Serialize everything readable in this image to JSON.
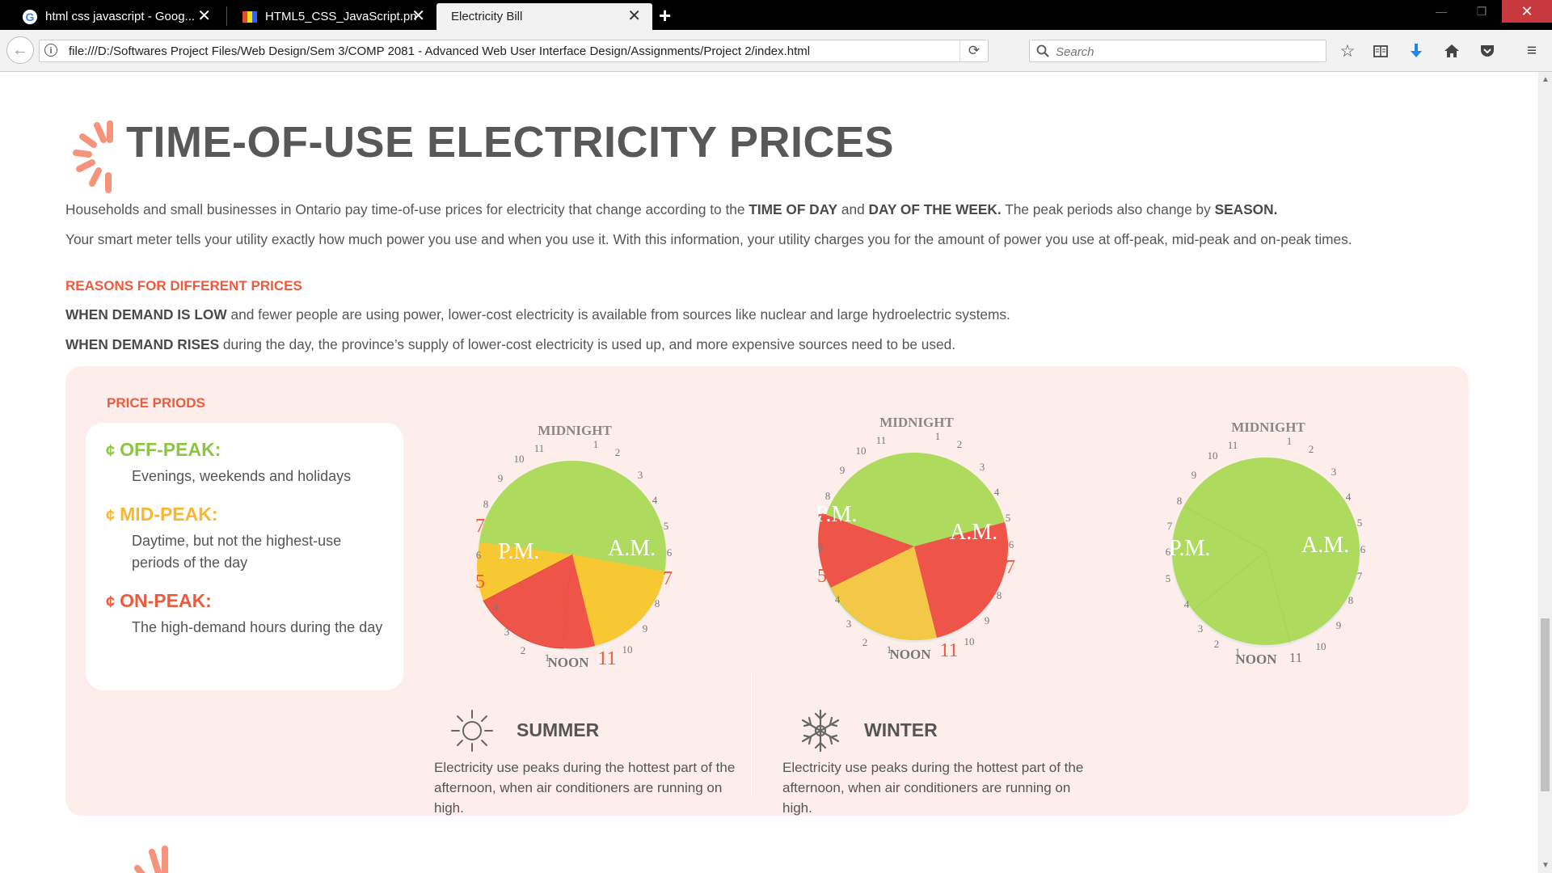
{
  "browser": {
    "tabs": [
      {
        "label": "html css javascript - Goog..."
      },
      {
        "label": "HTML5_CSS_JavaScript.pn..."
      },
      {
        "label": "Electricity Bill"
      }
    ],
    "url": "file:///D:/Softwares Project Files/Web Design/Sem 3/COMP 2081 - Advanced Web User Interface Design/Assignments/Project 2/index.html",
    "search_placeholder": "Search"
  },
  "page": {
    "title": "TIME-OF-USE ELECTRICITY PRICES",
    "intro1": {
      "a": "Households and small businesses in Ontario pay time-of-use prices for electricity that change according to the ",
      "b": "TIME OF DAY",
      "c": " and ",
      "d": "DAY OF THE WEEK.",
      "e": " The peak periods also change by ",
      "f": "SEASON."
    },
    "intro2": "Your smart meter tells your utility exactly how much power you use and when you use it. With this information, your utility charges you for the amount of power you use at off-peak, mid-peak and on-peak times.",
    "reasons_heading": "REASONS FOR DIFFERENT PRICES",
    "reason1": {
      "bold": "WHEN DEMAND IS LOW",
      "rest": " and fewer people are using power, lower-cost electricity is available from sources like nuclear and large hydroelectric systems."
    },
    "reason2": {
      "bold": "WHEN DEMAND RISES",
      "rest": " during the day, the province’s supply of lower-cost electricity is used up, and more expensive sources need to be used."
    },
    "price_heading": "PRICE PRIODS",
    "legend": [
      {
        "symbol": "¢",
        "title": "OFF-PEAK:",
        "desc": "Evenings, weekends and holidays",
        "color": "#8cc63f"
      },
      {
        "symbol": "¢",
        "title": "MID-PEAK:",
        "desc": "Daytime, but not the highest-use periods of the day",
        "color": "#f7b733"
      },
      {
        "symbol": "¢",
        "title": "ON-PEAK:",
        "desc": "The high-demand hours during the day",
        "color": "#ef5a3d"
      }
    ],
    "clock_labels": {
      "midnight": "MIDNIGHT",
      "noon": "NOON",
      "am": "A.M.",
      "pm": "P.M."
    },
    "seasons": [
      {
        "title": "SUMMER",
        "icon": "sun-icon",
        "desc": "Electricity use peaks during the hottest part of the afternoon, when air conditioners are running on high."
      },
      {
        "title": "WINTER",
        "icon": "snowflake-icon",
        "desc": "Electricity use peaks during the hottest part of the afternoon, when air conditioners are running on high."
      }
    ]
  },
  "colors": {
    "off_peak": "#aedb5e",
    "mid_peak": "#f7c832",
    "on_peak": "#ee5448",
    "accent": "#ef5a3d"
  }
}
